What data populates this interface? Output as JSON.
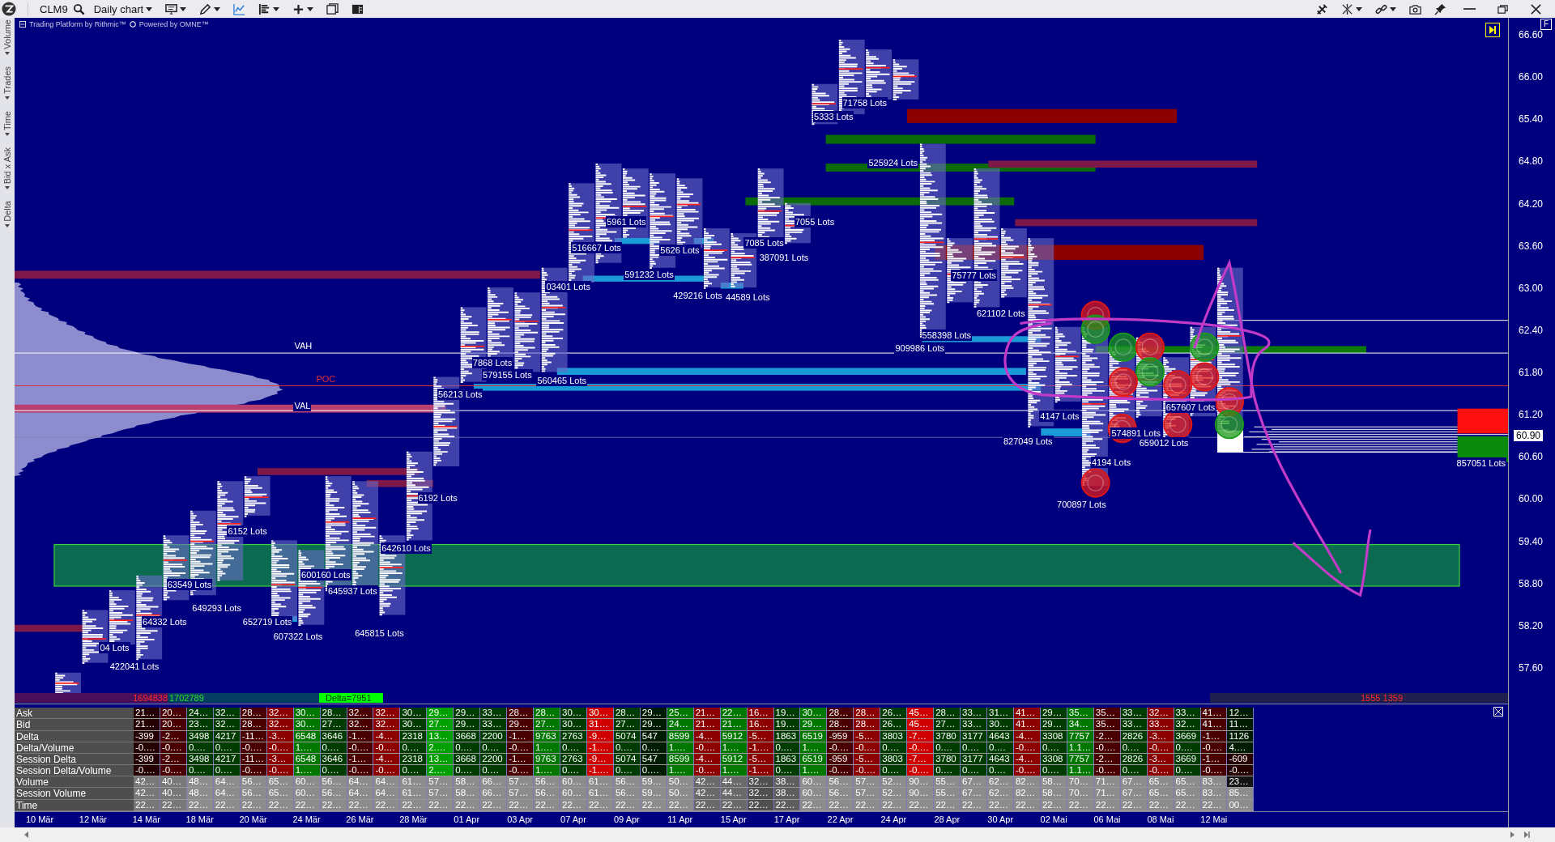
{
  "toolbar": {
    "symbol": "CLM9",
    "chart_type": "Daily chart"
  },
  "chart_header": {
    "platform": "Trading Platform by Rithmic™",
    "powered": "Powered by OMNE™"
  },
  "side_tabs": [
    "Volume",
    "Trades",
    "Time",
    "Bid x Ask",
    "Delta"
  ],
  "levels": [
    {
      "label": "VAH",
      "kind": "value-area"
    },
    {
      "label": "POC",
      "kind": "poc"
    },
    {
      "label": "VAL",
      "kind": "value-area"
    }
  ],
  "lot_labels": [
    "04 Lots",
    "422041 Lots",
    "64332 Lots",
    "63549 Lots",
    "649293 Lots",
    "6152 Lots",
    "652719 Lots",
    "607322 Lots",
    "600160 Lots",
    "645937 Lots",
    "645815 Lots",
    "642610 Lots",
    "6192 Lots",
    "56213 Lots",
    "7868 Lots",
    "579155 Lots",
    "560465 Lots",
    "03401 Lots",
    "516667 Lots",
    "5961 Lots",
    "591232 Lots",
    "5626 Lots",
    "429216 Lots",
    "44589 Lots",
    "7085 Lots",
    "387091 Lots",
    "7055 Lots",
    "5333 Lots",
    "71758 Lots",
    "525924 Lots",
    "909986 Lots",
    "558398 Lots",
    "75777 Lots",
    "621102 Lots",
    "827049 Lots",
    "4147 Lots",
    "4194 Lots",
    "700897 Lots",
    "574891 Lots",
    "659012 Lots",
    "657607 Lots",
    "857051 Lots"
  ],
  "footer_left": {
    "sell": "1694838",
    "buy": "1702789",
    "delta": "Delta=7951"
  },
  "footer_right": {
    "text": "1555 1359"
  },
  "price_axis": {
    "mode_badge": "F",
    "ticks": [
      "66.60",
      "66.00",
      "65.40",
      "64.80",
      "64.20",
      "63.60",
      "63.00",
      "62.40",
      "61.80",
      "61.20",
      "60.60",
      "60.00",
      "59.40",
      "58.80",
      "58.20",
      "57.60"
    ],
    "current": "60.90"
  },
  "table": {
    "rows": [
      {
        "label": "Ask",
        "cells": [
          {
            "text": "21…",
            "color": "#240000"
          },
          {
            "text": "20…",
            "color": "#4a0000"
          },
          {
            "text": "24…",
            "color": "#003c00"
          },
          {
            "text": "32…",
            "color": "#003c00"
          },
          {
            "text": "28…",
            "color": "#4a0000"
          },
          {
            "text": "32…",
            "color": "#8c0000"
          },
          {
            "text": "30…",
            "color": "#007800"
          },
          {
            "text": "28…",
            "color": "#003c00"
          },
          {
            "text": "32…",
            "color": "#4a0000"
          },
          {
            "text": "32…",
            "color": "#8c0000"
          },
          {
            "text": "30…",
            "color": "#003c00"
          },
          {
            "text": "29…",
            "color": "#00a000"
          },
          {
            "text": "29…",
            "color": "#003c00"
          },
          {
            "text": "33…",
            "color": "#003c00"
          },
          {
            "text": "28…",
            "color": "#4a0000"
          },
          {
            "text": "28…",
            "color": "#007800"
          },
          {
            "text": "30…",
            "color": "#003c00"
          },
          {
            "text": "30…",
            "color": "#d00000"
          },
          {
            "text": "28…",
            "color": "#003c00"
          },
          {
            "text": "29…",
            "color": "#001c00"
          },
          {
            "text": "25…",
            "color": "#007800"
          },
          {
            "text": "21…",
            "color": "#8c0000"
          },
          {
            "text": "22…",
            "color": "#007800"
          },
          {
            "text": "16…",
            "color": "#8c0000"
          },
          {
            "text": "19…",
            "color": "#003c00"
          },
          {
            "text": "30…",
            "color": "#007800"
          },
          {
            "text": "28…",
            "color": "#4a0000"
          },
          {
            "text": "28…",
            "color": "#8c0000"
          },
          {
            "text": "26…",
            "color": "#003c00"
          },
          {
            "text": "45…",
            "color": "#d00000"
          },
          {
            "text": "28…",
            "color": "#003c00"
          },
          {
            "text": "33…",
            "color": "#003c00"
          },
          {
            "text": "31…",
            "color": "#003c00"
          },
          {
            "text": "41…",
            "color": "#8c0000"
          },
          {
            "text": "29…",
            "color": "#003c00"
          },
          {
            "text": "35…",
            "color": "#007800"
          },
          {
            "text": "35…",
            "color": "#4a0000"
          },
          {
            "text": "33…",
            "color": "#003c00"
          },
          {
            "text": "32…",
            "color": "#8c0000"
          },
          {
            "text": "33…",
            "color": "#003c00"
          },
          {
            "text": "41…",
            "color": "#4a0000"
          },
          {
            "text": "12…",
            "color": "#001c00"
          }
        ]
      },
      {
        "label": "Bid",
        "cells": [
          {
            "text": "21…",
            "color": "#240000"
          },
          {
            "text": "20…",
            "color": "#4a0000"
          },
          {
            "text": "23…",
            "color": "#003c00"
          },
          {
            "text": "32…",
            "color": "#003c00"
          },
          {
            "text": "28…",
            "color": "#4a0000"
          },
          {
            "text": "32…",
            "color": "#8c0000"
          },
          {
            "text": "30…",
            "color": "#007800"
          },
          {
            "text": "27…",
            "color": "#003c00"
          },
          {
            "text": "32…",
            "color": "#4a0000"
          },
          {
            "text": "32…",
            "color": "#8c0000"
          },
          {
            "text": "30…",
            "color": "#003c00"
          },
          {
            "text": "27…",
            "color": "#00a000"
          },
          {
            "text": "29…",
            "color": "#003c00"
          },
          {
            "text": "33…",
            "color": "#003c00"
          },
          {
            "text": "29…",
            "color": "#4a0000"
          },
          {
            "text": "27…",
            "color": "#007800"
          },
          {
            "text": "30…",
            "color": "#003c00"
          },
          {
            "text": "31…",
            "color": "#d00000"
          },
          {
            "text": "27…",
            "color": "#003c00"
          },
          {
            "text": "29…",
            "color": "#001c00"
          },
          {
            "text": "24…",
            "color": "#007800"
          },
          {
            "text": "21…",
            "color": "#8c0000"
          },
          {
            "text": "21…",
            "color": "#007800"
          },
          {
            "text": "16…",
            "color": "#8c0000"
          },
          {
            "text": "19…",
            "color": "#003c00"
          },
          {
            "text": "29…",
            "color": "#007800"
          },
          {
            "text": "28…",
            "color": "#4a0000"
          },
          {
            "text": "28…",
            "color": "#8c0000"
          },
          {
            "text": "26…",
            "color": "#003c00"
          },
          {
            "text": "45…",
            "color": "#d00000"
          },
          {
            "text": "27…",
            "color": "#003c00"
          },
          {
            "text": "33…",
            "color": "#003c00"
          },
          {
            "text": "30…",
            "color": "#003c00"
          },
          {
            "text": "41…",
            "color": "#8c0000"
          },
          {
            "text": "29…",
            "color": "#003c00"
          },
          {
            "text": "34…",
            "color": "#007800"
          },
          {
            "text": "35…",
            "color": "#4a0000"
          },
          {
            "text": "33…",
            "color": "#003c00"
          },
          {
            "text": "33…",
            "color": "#8c0000"
          },
          {
            "text": "32…",
            "color": "#003c00"
          },
          {
            "text": "41…",
            "color": "#4a0000"
          },
          {
            "text": "11…",
            "color": "#001c00"
          }
        ]
      },
      {
        "label": "Delta",
        "cells": [
          {
            "text": "-399",
            "color": "#240000"
          },
          {
            "text": "-2…",
            "color": "#4a0000"
          },
          {
            "text": "3498",
            "color": "#003c00"
          },
          {
            "text": "4217",
            "color": "#003c00"
          },
          {
            "text": "-11…",
            "color": "#4a0000"
          },
          {
            "text": "-3…",
            "color": "#8c0000"
          },
          {
            "text": "6548",
            "color": "#007800"
          },
          {
            "text": "3646",
            "color": "#003c00"
          },
          {
            "text": "-1…",
            "color": "#4a0000"
          },
          {
            "text": "-4…",
            "color": "#8c0000"
          },
          {
            "text": "2318",
            "color": "#003c00"
          },
          {
            "text": "13…",
            "color": "#00a000"
          },
          {
            "text": "3668",
            "color": "#003c00"
          },
          {
            "text": "2200",
            "color": "#003c00"
          },
          {
            "text": "-1…",
            "color": "#4a0000"
          },
          {
            "text": "9763",
            "color": "#007800"
          },
          {
            "text": "2763",
            "color": "#003c00"
          },
          {
            "text": "-9…",
            "color": "#d00000"
          },
          {
            "text": "5074",
            "color": "#003c00"
          },
          {
            "text": "547",
            "color": "#001c00"
          },
          {
            "text": "8599",
            "color": "#007800"
          },
          {
            "text": "-4…",
            "color": "#8c0000"
          },
          {
            "text": "5912",
            "color": "#007800"
          },
          {
            "text": "-5…",
            "color": "#8c0000"
          },
          {
            "text": "1863",
            "color": "#003c00"
          },
          {
            "text": "6519",
            "color": "#007800"
          },
          {
            "text": "-959",
            "color": "#4a0000"
          },
          {
            "text": "-5…",
            "color": "#8c0000"
          },
          {
            "text": "3803",
            "color": "#003c00"
          },
          {
            "text": "-7…",
            "color": "#d00000"
          },
          {
            "text": "3780",
            "color": "#003c00"
          },
          {
            "text": "3177",
            "color": "#003c00"
          },
          {
            "text": "4643",
            "color": "#003c00"
          },
          {
            "text": "-4…",
            "color": "#8c0000"
          },
          {
            "text": "3308",
            "color": "#003c00"
          },
          {
            "text": "7757",
            "color": "#007800"
          },
          {
            "text": "-2…",
            "color": "#4a0000"
          },
          {
            "text": "2826",
            "color": "#003c00"
          },
          {
            "text": "-3…",
            "color": "#8c0000"
          },
          {
            "text": "3669",
            "color": "#003c00"
          },
          {
            "text": "-1…",
            "color": "#4a0000"
          },
          {
            "text": "1126",
            "color": "#001c00"
          }
        ]
      },
      {
        "label": "Delta/Volume",
        "cells": [
          {
            "text": "-0.…",
            "color": "#240000"
          },
          {
            "text": "-0.…",
            "color": "#4a0000"
          },
          {
            "text": "0.…",
            "color": "#003c00"
          },
          {
            "text": "0.…",
            "color": "#003c00"
          },
          {
            "text": "-0.…",
            "color": "#4a0000"
          },
          {
            "text": "-0.…",
            "color": "#8c0000"
          },
          {
            "text": "1.…",
            "color": "#007800"
          },
          {
            "text": "0.…",
            "color": "#003c00"
          },
          {
            "text": "-0.…",
            "color": "#4a0000"
          },
          {
            "text": "-0.…",
            "color": "#8c0000"
          },
          {
            "text": "0.…",
            "color": "#003c00"
          },
          {
            "text": "2.…",
            "color": "#00a000"
          },
          {
            "text": "0.…",
            "color": "#003c00"
          },
          {
            "text": "0.…",
            "color": "#003c00"
          },
          {
            "text": "-0.…",
            "color": "#4a0000"
          },
          {
            "text": "1.…",
            "color": "#007800"
          },
          {
            "text": "0.…",
            "color": "#003c00"
          },
          {
            "text": "-1.…",
            "color": "#d00000"
          },
          {
            "text": "0.…",
            "color": "#003c00"
          },
          {
            "text": "0.…",
            "color": "#001c00"
          },
          {
            "text": "1.…",
            "color": "#007800"
          },
          {
            "text": "-0.…",
            "color": "#8c0000"
          },
          {
            "text": "1.…",
            "color": "#007800"
          },
          {
            "text": "-1.…",
            "color": "#8c0000"
          },
          {
            "text": "0.…",
            "color": "#003c00"
          },
          {
            "text": "1.…",
            "color": "#007800"
          },
          {
            "text": "-0.…",
            "color": "#4a0000"
          },
          {
            "text": "-0.…",
            "color": "#8c0000"
          },
          {
            "text": "0.…",
            "color": "#003c00"
          },
          {
            "text": "-0.…",
            "color": "#d00000"
          },
          {
            "text": "0.…",
            "color": "#003c00"
          },
          {
            "text": "0.…",
            "color": "#003c00"
          },
          {
            "text": "0.…",
            "color": "#003c00"
          },
          {
            "text": "-0.…",
            "color": "#8c0000"
          },
          {
            "text": "0.…",
            "color": "#003c00"
          },
          {
            "text": "1.1…",
            "color": "#007800"
          },
          {
            "text": "-0.…",
            "color": "#4a0000"
          },
          {
            "text": "0.…",
            "color": "#003c00"
          },
          {
            "text": "-0.…",
            "color": "#8c0000"
          },
          {
            "text": "0.…",
            "color": "#003c00"
          },
          {
            "text": "-0.…",
            "color": "#4a0000"
          },
          {
            "text": "4.…",
            "color": "#001c00"
          }
        ]
      },
      {
        "label": "Session Delta",
        "cells": [
          {
            "text": "-399",
            "color": "#240000"
          },
          {
            "text": "-2…",
            "color": "#4a0000"
          },
          {
            "text": "3498",
            "color": "#003c00"
          },
          {
            "text": "4217",
            "color": "#003c00"
          },
          {
            "text": "-11…",
            "color": "#4a0000"
          },
          {
            "text": "-3…",
            "color": "#8c0000"
          },
          {
            "text": "6548",
            "color": "#007800"
          },
          {
            "text": "3646",
            "color": "#003c00"
          },
          {
            "text": "-1…",
            "color": "#4a0000"
          },
          {
            "text": "-4…",
            "color": "#8c0000"
          },
          {
            "text": "2318",
            "color": "#003c00"
          },
          {
            "text": "13…",
            "color": "#00a000"
          },
          {
            "text": "3668",
            "color": "#003c00"
          },
          {
            "text": "2200",
            "color": "#003c00"
          },
          {
            "text": "-1…",
            "color": "#4a0000"
          },
          {
            "text": "9763",
            "color": "#007800"
          },
          {
            "text": "2763",
            "color": "#003c00"
          },
          {
            "text": "-9…",
            "color": "#d00000"
          },
          {
            "text": "5074",
            "color": "#003c00"
          },
          {
            "text": "547",
            "color": "#001c00"
          },
          {
            "text": "8599",
            "color": "#007800"
          },
          {
            "text": "-4…",
            "color": "#8c0000"
          },
          {
            "text": "5912",
            "color": "#007800"
          },
          {
            "text": "-5…",
            "color": "#8c0000"
          },
          {
            "text": "1863",
            "color": "#003c00"
          },
          {
            "text": "6519",
            "color": "#007800"
          },
          {
            "text": "-959",
            "color": "#4a0000"
          },
          {
            "text": "-5…",
            "color": "#8c0000"
          },
          {
            "text": "3803",
            "color": "#003c00"
          },
          {
            "text": "-7…",
            "color": "#d00000"
          },
          {
            "text": "3780",
            "color": "#003c00"
          },
          {
            "text": "3177",
            "color": "#003c00"
          },
          {
            "text": "4643",
            "color": "#003c00"
          },
          {
            "text": "-4…",
            "color": "#8c0000"
          },
          {
            "text": "3308",
            "color": "#003c00"
          },
          {
            "text": "7757",
            "color": "#007800"
          },
          {
            "text": "-2…",
            "color": "#4a0000"
          },
          {
            "text": "2826",
            "color": "#003c00"
          },
          {
            "text": "-3…",
            "color": "#8c0000"
          },
          {
            "text": "3669",
            "color": "#003c00"
          },
          {
            "text": "-1…",
            "color": "#4a0000"
          },
          {
            "text": "-609",
            "color": "#240000"
          }
        ]
      },
      {
        "label": "Session Delta/Volume",
        "cells": [
          {
            "text": "-0.…",
            "color": "#240000"
          },
          {
            "text": "-0.…",
            "color": "#4a0000"
          },
          {
            "text": "0.…",
            "color": "#003c00"
          },
          {
            "text": "0.…",
            "color": "#003c00"
          },
          {
            "text": "-0.…",
            "color": "#4a0000"
          },
          {
            "text": "-0.…",
            "color": "#8c0000"
          },
          {
            "text": "1.…",
            "color": "#007800"
          },
          {
            "text": "0.…",
            "color": "#003c00"
          },
          {
            "text": "-0.…",
            "color": "#4a0000"
          },
          {
            "text": "-0.…",
            "color": "#8c0000"
          },
          {
            "text": "0.…",
            "color": "#003c00"
          },
          {
            "text": "2.…",
            "color": "#00a000"
          },
          {
            "text": "0.…",
            "color": "#003c00"
          },
          {
            "text": "0.…",
            "color": "#003c00"
          },
          {
            "text": "-0.…",
            "color": "#4a0000"
          },
          {
            "text": "1.…",
            "color": "#007800"
          },
          {
            "text": "0.…",
            "color": "#003c00"
          },
          {
            "text": "-1.…",
            "color": "#d00000"
          },
          {
            "text": "0.…",
            "color": "#003c00"
          },
          {
            "text": "0.…",
            "color": "#001c00"
          },
          {
            "text": "1.…",
            "color": "#007800"
          },
          {
            "text": "-0.…",
            "color": "#8c0000"
          },
          {
            "text": "1.…",
            "color": "#007800"
          },
          {
            "text": "-1.…",
            "color": "#8c0000"
          },
          {
            "text": "0.…",
            "color": "#003c00"
          },
          {
            "text": "1.…",
            "color": "#007800"
          },
          {
            "text": "-0.…",
            "color": "#4a0000"
          },
          {
            "text": "-0.…",
            "color": "#8c0000"
          },
          {
            "text": "0.…",
            "color": "#003c00"
          },
          {
            "text": "-0.…",
            "color": "#d00000"
          },
          {
            "text": "0.…",
            "color": "#003c00"
          },
          {
            "text": "0.…",
            "color": "#003c00"
          },
          {
            "text": "0.…",
            "color": "#003c00"
          },
          {
            "text": "-0.…",
            "color": "#8c0000"
          },
          {
            "text": "0.…",
            "color": "#003c00"
          },
          {
            "text": "1.1…",
            "color": "#007800"
          },
          {
            "text": "-0.…",
            "color": "#4a0000"
          },
          {
            "text": "0.…",
            "color": "#003c00"
          },
          {
            "text": "-0.…",
            "color": "#8c0000"
          },
          {
            "text": "0.…",
            "color": "#003c00"
          },
          {
            "text": "-0.…",
            "color": "#4a0000"
          },
          {
            "text": "-0.…",
            "color": "#240000"
          }
        ]
      },
      {
        "label": "Volume",
        "cells": [
          {
            "text": "42…",
            "color": "#787878"
          },
          {
            "text": "40…",
            "color": "#787878"
          },
          {
            "text": "48…",
            "color": "#8c8c8c"
          },
          {
            "text": "64…",
            "color": "#8c8c8c"
          },
          {
            "text": "56…",
            "color": "#8c8c8c"
          },
          {
            "text": "65…",
            "color": "#8c8c8c"
          },
          {
            "text": "60…",
            "color": "#8c8c8c"
          },
          {
            "text": "56…",
            "color": "#8c8c8c"
          },
          {
            "text": "64…",
            "color": "#8c8c8c"
          },
          {
            "text": "64…",
            "color": "#8c8c8c"
          },
          {
            "text": "61…",
            "color": "#8c8c8c"
          },
          {
            "text": "57…",
            "color": "#8c8c8c"
          },
          {
            "text": "58…",
            "color": "#8c8c8c"
          },
          {
            "text": "66…",
            "color": "#8c8c8c"
          },
          {
            "text": "57…",
            "color": "#8c8c8c"
          },
          {
            "text": "56…",
            "color": "#8c8c8c"
          },
          {
            "text": "60…",
            "color": "#8c8c8c"
          },
          {
            "text": "61…",
            "color": "#8c8c8c"
          },
          {
            "text": "56…",
            "color": "#8c8c8c"
          },
          {
            "text": "59…",
            "color": "#8c8c8c"
          },
          {
            "text": "50…",
            "color": "#8c8c8c"
          },
          {
            "text": "42…",
            "color": "#6a6a6a"
          },
          {
            "text": "44…",
            "color": "#6a6a6a"
          },
          {
            "text": "32…",
            "color": "#505050"
          },
          {
            "text": "38…",
            "color": "#5e5e5e"
          },
          {
            "text": "60…",
            "color": "#8c8c8c"
          },
          {
            "text": "56…",
            "color": "#8c8c8c"
          },
          {
            "text": "57…",
            "color": "#8c8c8c"
          },
          {
            "text": "52…",
            "color": "#8c8c8c"
          },
          {
            "text": "90…",
            "color": "#8c8c8c"
          },
          {
            "text": "55…",
            "color": "#8c8c8c"
          },
          {
            "text": "67…",
            "color": "#8c8c8c"
          },
          {
            "text": "62…",
            "color": "#8c8c8c"
          },
          {
            "text": "82…",
            "color": "#8c8c8c"
          },
          {
            "text": "58…",
            "color": "#8c8c8c"
          },
          {
            "text": "70…",
            "color": "#8c8c8c"
          },
          {
            "text": "71…",
            "color": "#8c8c8c"
          },
          {
            "text": "67…",
            "color": "#8c8c8c"
          },
          {
            "text": "65…",
            "color": "#8c8c8c"
          },
          {
            "text": "65…",
            "color": "#8c8c8c"
          },
          {
            "text": "83…",
            "color": "#8c8c8c"
          },
          {
            "text": "23…",
            "color": "#141414"
          }
        ]
      },
      {
        "label": "Session Volume",
        "cells": [
          {
            "text": "42…",
            "color": "#787878"
          },
          {
            "text": "40…",
            "color": "#787878"
          },
          {
            "text": "48…",
            "color": "#8c8c8c"
          },
          {
            "text": "64…",
            "color": "#8c8c8c"
          },
          {
            "text": "56…",
            "color": "#8c8c8c"
          },
          {
            "text": "65…",
            "color": "#8c8c8c"
          },
          {
            "text": "60…",
            "color": "#8c8c8c"
          },
          {
            "text": "56…",
            "color": "#8c8c8c"
          },
          {
            "text": "64…",
            "color": "#8c8c8c"
          },
          {
            "text": "64…",
            "color": "#8c8c8c"
          },
          {
            "text": "61…",
            "color": "#8c8c8c"
          },
          {
            "text": "57…",
            "color": "#8c8c8c"
          },
          {
            "text": "58…",
            "color": "#8c8c8c"
          },
          {
            "text": "66…",
            "color": "#8c8c8c"
          },
          {
            "text": "57…",
            "color": "#8c8c8c"
          },
          {
            "text": "56…",
            "color": "#8c8c8c"
          },
          {
            "text": "60…",
            "color": "#8c8c8c"
          },
          {
            "text": "61…",
            "color": "#8c8c8c"
          },
          {
            "text": "56…",
            "color": "#8c8c8c"
          },
          {
            "text": "59…",
            "color": "#8c8c8c"
          },
          {
            "text": "50…",
            "color": "#8c8c8c"
          },
          {
            "text": "42…",
            "color": "#6a6a6a"
          },
          {
            "text": "44…",
            "color": "#6a6a6a"
          },
          {
            "text": "32…",
            "color": "#505050"
          },
          {
            "text": "38…",
            "color": "#5e5e5e"
          },
          {
            "text": "60…",
            "color": "#8c8c8c"
          },
          {
            "text": "56…",
            "color": "#8c8c8c"
          },
          {
            "text": "57…",
            "color": "#8c8c8c"
          },
          {
            "text": "52…",
            "color": "#8c8c8c"
          },
          {
            "text": "90…",
            "color": "#8c8c8c"
          },
          {
            "text": "55…",
            "color": "#8c8c8c"
          },
          {
            "text": "67…",
            "color": "#8c8c8c"
          },
          {
            "text": "62…",
            "color": "#8c8c8c"
          },
          {
            "text": "82…",
            "color": "#8c8c8c"
          },
          {
            "text": "58…",
            "color": "#8c8c8c"
          },
          {
            "text": "70…",
            "color": "#8c8c8c"
          },
          {
            "text": "71…",
            "color": "#8c8c8c"
          },
          {
            "text": "67…",
            "color": "#8c8c8c"
          },
          {
            "text": "65…",
            "color": "#8c8c8c"
          },
          {
            "text": "65…",
            "color": "#8c8c8c"
          },
          {
            "text": "83…",
            "color": "#8c8c8c"
          },
          {
            "text": "85…",
            "color": "#8c8c8c"
          }
        ]
      },
      {
        "label": "Time",
        "cells": [
          {
            "text": "22…",
            "color": "#787878"
          },
          {
            "text": "22…",
            "color": "#787878"
          },
          {
            "text": "22…",
            "color": "#8c8c8c"
          },
          {
            "text": "22…",
            "color": "#8c8c8c"
          },
          {
            "text": "22…",
            "color": "#8c8c8c"
          },
          {
            "text": "22…",
            "color": "#8c8c8c"
          },
          {
            "text": "22…",
            "color": "#8c8c8c"
          },
          {
            "text": "22…",
            "color": "#8c8c8c"
          },
          {
            "text": "22…",
            "color": "#8c8c8c"
          },
          {
            "text": "22…",
            "color": "#8c8c8c"
          },
          {
            "text": "22…",
            "color": "#8c8c8c"
          },
          {
            "text": "22…",
            "color": "#8c8c8c"
          },
          {
            "text": "22…",
            "color": "#8c8c8c"
          },
          {
            "text": "22…",
            "color": "#8c8c8c"
          },
          {
            "text": "22…",
            "color": "#8c8c8c"
          },
          {
            "text": "22…",
            "color": "#8c8c8c"
          },
          {
            "text": "22…",
            "color": "#8c8c8c"
          },
          {
            "text": "22…",
            "color": "#8c8c8c"
          },
          {
            "text": "22…",
            "color": "#8c8c8c"
          },
          {
            "text": "22…",
            "color": "#8c8c8c"
          },
          {
            "text": "22…",
            "color": "#8c8c8c"
          },
          {
            "text": "22…",
            "color": "#6a6a6a"
          },
          {
            "text": "22…",
            "color": "#6a6a6a"
          },
          {
            "text": "22…",
            "color": "#505050"
          },
          {
            "text": "22…",
            "color": "#5e5e5e"
          },
          {
            "text": "22…",
            "color": "#8c8c8c"
          },
          {
            "text": "22…",
            "color": "#8c8c8c"
          },
          {
            "text": "22…",
            "color": "#8c8c8c"
          },
          {
            "text": "22…",
            "color": "#8c8c8c"
          },
          {
            "text": "22…",
            "color": "#8c8c8c"
          },
          {
            "text": "22…",
            "color": "#8c8c8c"
          },
          {
            "text": "22…",
            "color": "#8c8c8c"
          },
          {
            "text": "22…",
            "color": "#8c8c8c"
          },
          {
            "text": "22…",
            "color": "#8c8c8c"
          },
          {
            "text": "22…",
            "color": "#8c8c8c"
          },
          {
            "text": "22…",
            "color": "#8c8c8c"
          },
          {
            "text": "22…",
            "color": "#8c8c8c"
          },
          {
            "text": "22…",
            "color": "#8c8c8c"
          },
          {
            "text": "22…",
            "color": "#8c8c8c"
          },
          {
            "text": "22…",
            "color": "#8c8c8c"
          },
          {
            "text": "22…",
            "color": "#8c8c8c"
          },
          {
            "text": "00…",
            "color": "#8c8c8c"
          }
        ]
      }
    ]
  },
  "dates": [
    "10 Mär",
    "12 Mär",
    "14 Mär",
    "18 Mär",
    "20 Mär",
    "24 Mär",
    "26 Mär",
    "28 Mär",
    "01 Apr",
    "03 Apr",
    "07 Apr",
    "09 Apr",
    "11 Apr",
    "15 Apr",
    "17 Apr",
    "22 Apr",
    "24 Apr",
    "28 Apr",
    "30 Apr",
    "02 Mai",
    "06 Mai",
    "08 Mai",
    "12 Mai"
  ]
}
